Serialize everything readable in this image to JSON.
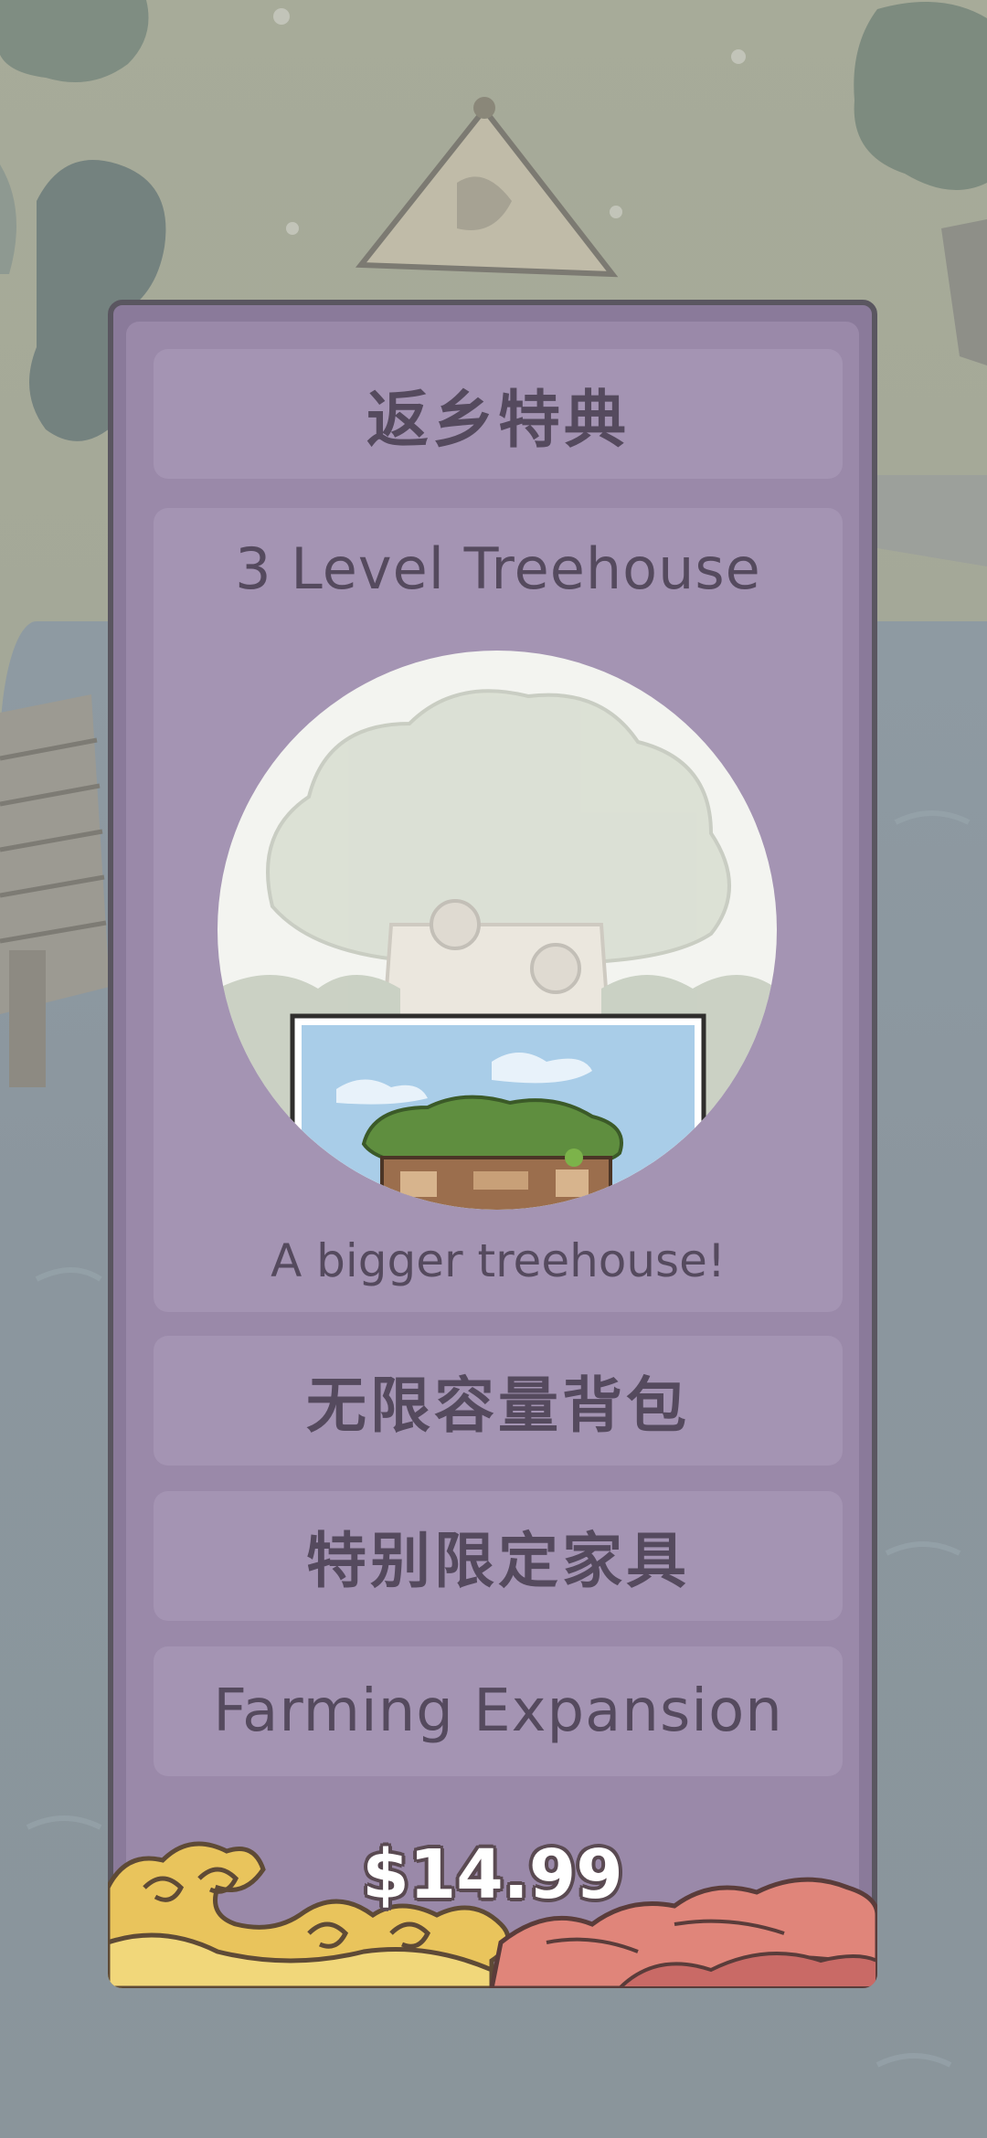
{
  "offer": {
    "title": "返乡特典",
    "feature": {
      "title": "3 Level Treehouse",
      "caption": "A bigger treehouse!"
    },
    "perks": [
      "无限容量背包",
      "特别限定家具",
      "Farming Expansion"
    ],
    "price": "$14.99"
  },
  "colors": {
    "panel_border": "#5a5660",
    "panel": "#8a7a9a",
    "card": "#a494b3",
    "text": "#554a5e",
    "price_text": "#ffffff"
  },
  "icons": {
    "decor": "wave-cloud-decoration",
    "image": "treehouse-illustration"
  }
}
